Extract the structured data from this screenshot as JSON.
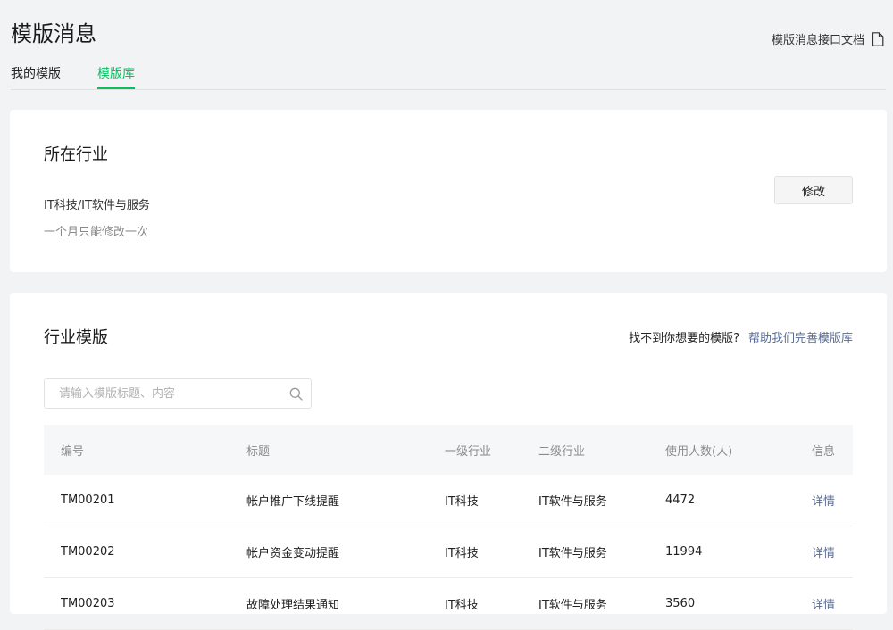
{
  "header": {
    "title": "模版消息",
    "doc_link": "模版消息接口文档",
    "tabs": [
      {
        "label": "我的模版"
      },
      {
        "label": "模版库"
      }
    ]
  },
  "industry_card": {
    "title": "所在行业",
    "value": "IT科技/IT软件与服务",
    "note": "一个月只能修改一次",
    "edit_button": "修改"
  },
  "templates_card": {
    "title": "行业模版",
    "not_found_text": "找不到你想要的模版?",
    "help_link": "帮助我们完善模版库",
    "search_placeholder": "请输入模版标题、内容",
    "columns": [
      "编号",
      "标题",
      "一级行业",
      "二级行业",
      "使用人数(人)",
      "信息"
    ],
    "rows": [
      {
        "id": "TM00201",
        "title": "帐户推广下线提醒",
        "primary": "IT科技",
        "secondary": "IT软件与服务",
        "users": "4472",
        "info": "详情"
      },
      {
        "id": "TM00202",
        "title": "帐户资金变动提醒",
        "primary": "IT科技",
        "secondary": "IT软件与服务",
        "users": "11994",
        "info": "详情"
      },
      {
        "id": "TM00203",
        "title": "故障处理结果通知",
        "primary": "IT科技",
        "secondary": "IT软件与服务",
        "users": "3560",
        "info": "详情"
      }
    ]
  },
  "colors": {
    "accent": "#07c160",
    "link": "#576b95"
  }
}
